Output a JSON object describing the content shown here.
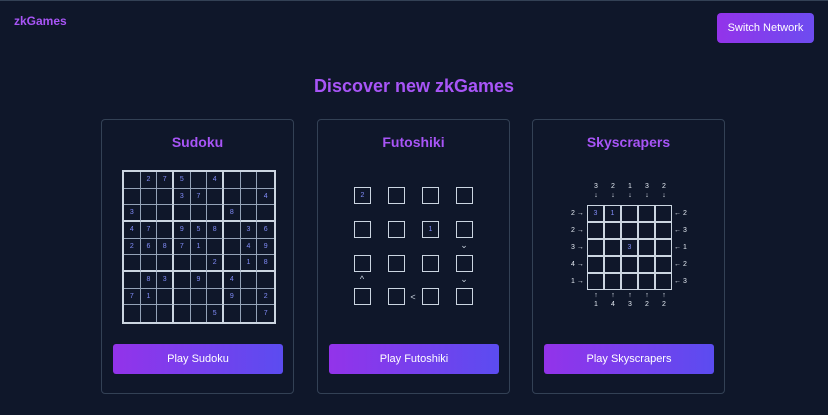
{
  "header": {
    "brand": "zkGames",
    "switch_network_label": "Switch Network"
  },
  "main": {
    "heading": "Discover new zkGames"
  },
  "games": {
    "sudoku": {
      "title": "Sudoku",
      "play_label": "Play Sudoku",
      "grid": [
        [
          "",
          "2",
          "7",
          "5",
          "",
          "4",
          "",
          "",
          ""
        ],
        [
          "",
          "",
          "",
          "3",
          "7",
          "",
          "",
          "",
          "4"
        ],
        [
          "3",
          "",
          "",
          "",
          "",
          "",
          "8",
          "",
          ""
        ],
        [
          "4",
          "7",
          "",
          "9",
          "5",
          "8",
          "",
          "3",
          "6"
        ],
        [
          "2",
          "6",
          "8",
          "7",
          "1",
          "",
          "",
          "4",
          "9"
        ],
        [
          "",
          "",
          "",
          "",
          "",
          "2",
          "",
          "1",
          "8"
        ],
        [
          "",
          "8",
          "3",
          "",
          "9",
          "",
          "4",
          "",
          ""
        ],
        [
          "7",
          "1",
          "",
          "",
          "",
          "",
          "9",
          "",
          "2"
        ],
        [
          "",
          "",
          "",
          "",
          "",
          "5",
          "",
          "",
          "7"
        ]
      ]
    },
    "futoshiki": {
      "title": "Futoshiki",
      "play_label": "Play Futoshiki",
      "grid": [
        [
          "2",
          "",
          "",
          ""
        ],
        [
          "",
          "",
          "1",
          ""
        ],
        [
          "",
          "",
          "",
          ""
        ],
        [
          "",
          "",
          "",
          ""
        ]
      ],
      "inequalities": [
        {
          "between": "r1c3-r2c3",
          "symbol": "⌄"
        },
        {
          "between": "r2c0-r3c0",
          "symbol": "^"
        },
        {
          "between": "r2c3-r3c3",
          "symbol": "⌄"
        },
        {
          "between": "r3c1-r3c2",
          "symbol": "<"
        }
      ]
    },
    "skyscrapers": {
      "title": "Skyscrapers",
      "play_label": "Play Skyscrapers",
      "top_clues": [
        "3",
        "2",
        "1",
        "3",
        "2"
      ],
      "bottom_clues": [
        "1",
        "4",
        "3",
        "2",
        "2"
      ],
      "left_clues": [
        "2",
        "2",
        "3",
        "4",
        "1"
      ],
      "right_clues": [
        "2",
        "3",
        "1",
        "2",
        "3"
      ],
      "grid": [
        [
          "3",
          "1",
          "",
          "",
          ""
        ],
        [
          "",
          "",
          "",
          "",
          ""
        ],
        [
          "",
          "",
          "3",
          "",
          ""
        ],
        [
          "",
          "",
          "",
          "",
          ""
        ],
        [
          "",
          "",
          "",
          "",
          ""
        ]
      ],
      "arrows": {
        "down": "↓",
        "up": "↑",
        "right": "→",
        "left": "←"
      }
    }
  }
}
